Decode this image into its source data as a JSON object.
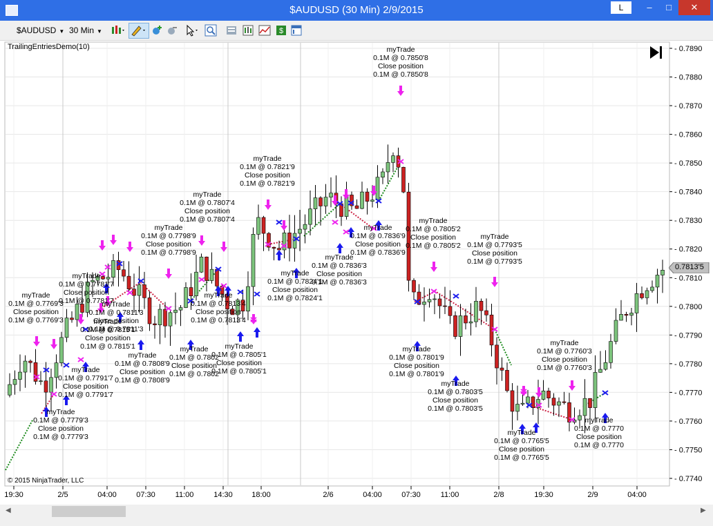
{
  "window": {
    "title": "$AUDUSD (30 Min)  2/9/2015",
    "layout_btn": "L",
    "minimize_label": "–",
    "maximize_label": "□",
    "close_label": "✕"
  },
  "toolbar": {
    "instrument": "$AUDUSD",
    "interval": "30 Min"
  },
  "chart": {
    "indicator_label": "TrailingEntriesDemo(10)",
    "copyright": "© 2015 NinjaTrader, LLC",
    "current_price": "0.7813'5",
    "y_ticks": [
      "0.7890",
      "0.7880",
      "0.7870",
      "0.7860",
      "0.7850",
      "0.7840",
      "0.7830",
      "0.7820",
      "0.7810",
      "0.7800",
      "0.7790",
      "0.7780",
      "0.7770",
      "0.7760",
      "0.7750",
      "0.7740"
    ],
    "x_ticks": [
      "19:30",
      "2/5",
      "04:00",
      "07:30",
      "11:00",
      "14:30",
      "18:00",
      "2/6",
      "04:00",
      "07:30",
      "11:00",
      "2/8",
      "19:30",
      "2/9",
      "04:00"
    ],
    "trades": [
      {
        "name": "myTrade",
        "l1": "0.1M @ 0.7850'8",
        "l2": "Close position",
        "l3": "0.1M @ 0.7850'8"
      },
      {
        "name": "myTrade",
        "l1": "0.1M @ 0.7821'9",
        "l2": "Close position",
        "l3": "0.1M @ 0.7821'9"
      },
      {
        "name": "myTrade",
        "l1": "0.1M @ 0.7805'2",
        "l2": "Close position",
        "l3": "0.1M @ 0.7805'2"
      },
      {
        "name": "myTrade",
        "l1": "0.1M @ 0.7793'5",
        "l2": "Close position",
        "l3": "0.1M @ 0.7793'5"
      },
      {
        "name": "myTrade",
        "l1": "0.1M @ 0.7798'9",
        "l2": "Close position",
        "l3": "0.1M @ 0.7798'9"
      },
      {
        "name": "myTrade",
        "l1": "0.1M @ 0.7807'4",
        "l2": "Close position",
        "l3": "0.1M @ 0.7807'4"
      },
      {
        "name": "myTrade",
        "l1": "0.1M @ 0.7836'9",
        "l2": "Close position",
        "l3": "0.1M @ 0.7836'9"
      },
      {
        "name": "myTrade",
        "l1": "0.1M @ 0.7836'3",
        "l2": "Close position",
        "l3": "0.1M @ 0.7836'3"
      },
      {
        "name": "myTrade",
        "l1": "0.1M @ 0.7824'1",
        "l2": "Close position",
        "l3": "0.1M @ 0.7824'1"
      },
      {
        "name": "myTrade",
        "l1": "0.1M @ 0.7813'4",
        "l2": "Close position",
        "l3": "0.1M @ 0.7813'4"
      },
      {
        "name": "myTrade",
        "l1": "0.1M @ 0.7802",
        "l2": "Close position",
        "l3": "0.1M @ 0.7802"
      },
      {
        "name": "myTrade",
        "l1": "0.1M @ 0.7805'1",
        "l2": "Close position",
        "l3": "0.1M @ 0.7805'1"
      },
      {
        "name": "myTrade",
        "l1": "0.1M @ 0.7801'9",
        "l2": "Close position",
        "l3": "0.1M @ 0.7801'9"
      },
      {
        "name": "myTrade",
        "l1": "0.1M @ 0.7803'5",
        "l2": "Close position",
        "l3": "0.1M @ 0.7803'5"
      },
      {
        "name": "myTrade",
        "l1": "0.1M @ 0.7808'9",
        "l2": "Close position",
        "l3": "0.1M @ 0.7808'9"
      },
      {
        "name": "myTrade",
        "l1": "0.1M @ 0.7791'7",
        "l2": "Close position",
        "l3": "0.1M @ 0.7791'7"
      },
      {
        "name": "myTrade",
        "l1": "0.1M @ 0.7815'1",
        "l2": "Close position",
        "l3": "0.1M @ 0.7815'1"
      },
      {
        "name": "myTrade",
        "l1": "0.1M @ 0.7811'3",
        "l2": "Close position",
        "l3": "0.1M @ 0.7811'3"
      },
      {
        "name": "myTrade",
        "l1": "0.1M @ 0.7760'3",
        "l2": "Close position",
        "l3": "0.1M @ 0.7760'3"
      },
      {
        "name": "myTrade",
        "l1": "0.1M @ 0.7770",
        "l2": "Close position",
        "l3": "0.1M @ 0.7770"
      },
      {
        "name": "myTrade",
        "l1": "0.1M @ 0.7765'5",
        "l2": "Close position",
        "l3": "0.1M @ 0.7765'5"
      },
      {
        "name": "myTrade",
        "l1": "0.1M @ 0.7779'3",
        "l2": "Close position",
        "l3": "0.1M @ 0.7779'3"
      },
      {
        "name": "myTrade",
        "l1": "0.1M @ 0.7769'3",
        "l2": "Close position",
        "l3": "0.1M @ 0.7769'3"
      },
      {
        "name": "myTrade",
        "l1": "0.1M @ 0.7781'7",
        "l2": "Close position",
        "l3": "0.1M @ 0.7781'7"
      }
    ]
  },
  "colors": {
    "titlebar": "#2f6fe6",
    "bull_candle": "#7dc47d",
    "bear_candle": "#cc2222",
    "buy_arrow": "#1a1aee",
    "sell_arrow": "#ee22ee",
    "trail_up": "#1a8a1a",
    "trail_down": "#cc2244"
  }
}
